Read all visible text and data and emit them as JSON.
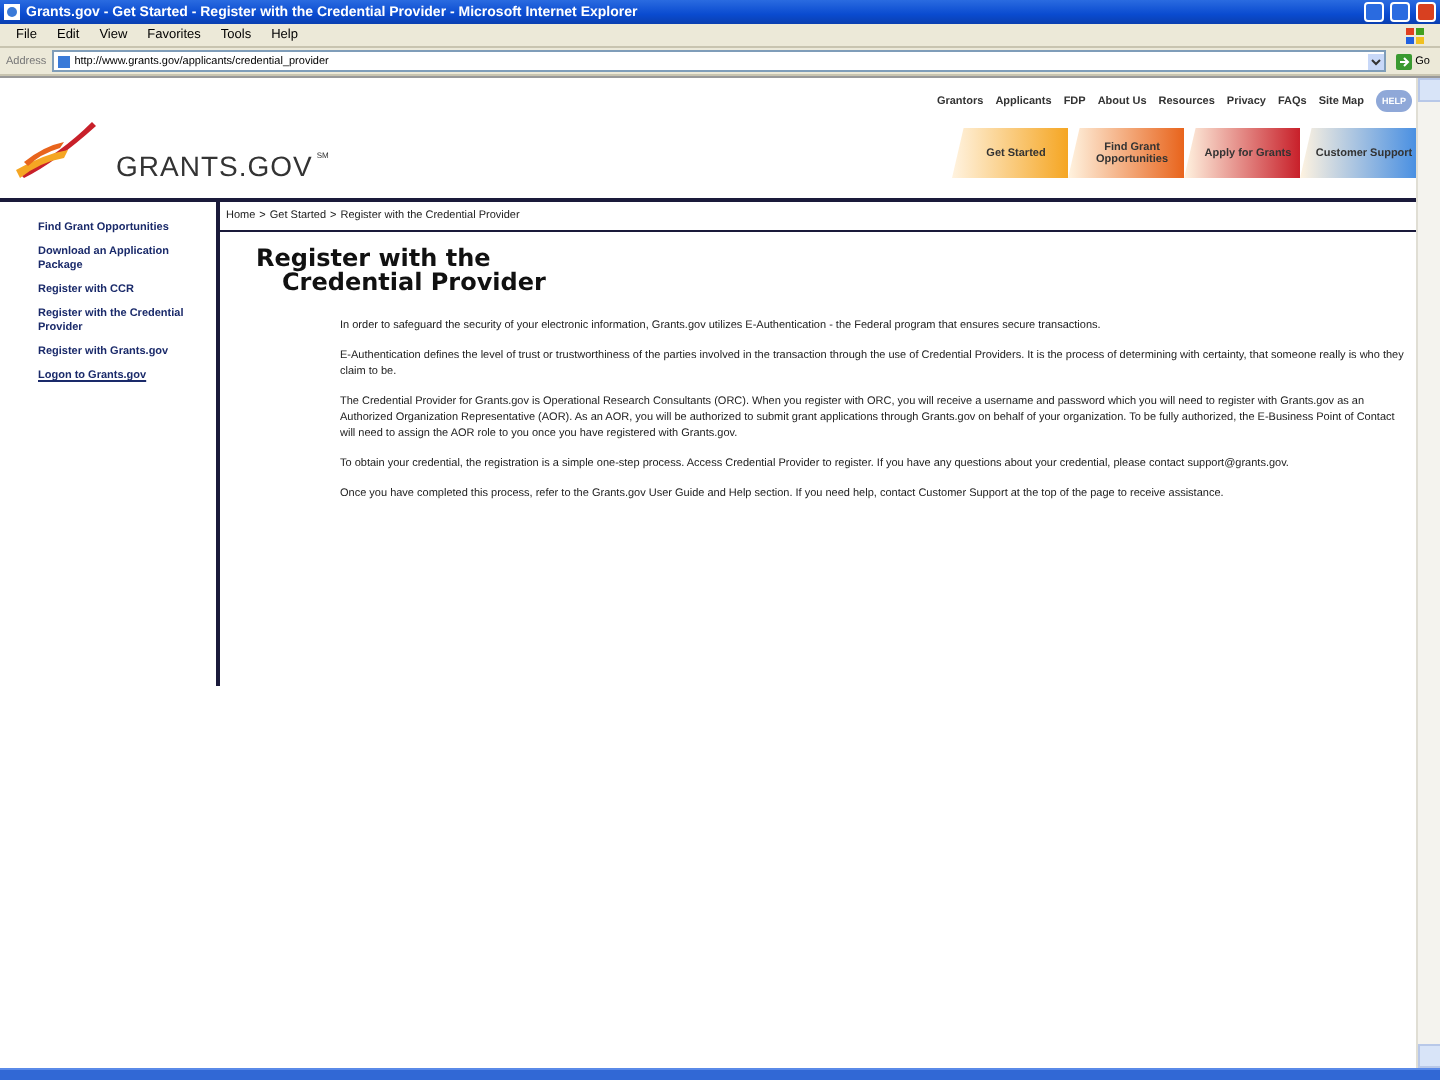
{
  "window": {
    "title": "Grants.gov - Get Started - Register with the Credential Provider - Microsoft Internet Explorer"
  },
  "menu": [
    "File",
    "Edit",
    "View",
    "Favorites",
    "Tools",
    "Help"
  ],
  "address": {
    "label": "Address",
    "url": "http://www.grants.gov/applicants/credential_provider",
    "go": "Go"
  },
  "logo": {
    "text": "GRANTS.GOV",
    "mark": "SM"
  },
  "top_links": [
    "Grantors",
    "Applicants",
    "FDP",
    "About Us",
    "Resources",
    "Privacy",
    "FAQs",
    "Site Map"
  ],
  "help_button": "HELP",
  "tabs": [
    {
      "label": "Get Started",
      "color": "#f5a623"
    },
    {
      "label": "Find Grant Opportunities",
      "color": "#e8641c"
    },
    {
      "label": "Apply for Grants",
      "color": "#c8202a"
    },
    {
      "label": "Customer Support",
      "color": "#4a90e2"
    }
  ],
  "sidebar": [
    {
      "label": "Find Grant Opportunities",
      "kind": "nav"
    },
    {
      "label": "Download an Application Package",
      "kind": "nav"
    },
    {
      "label": "Register with CCR",
      "kind": "nav"
    },
    {
      "label": "Register with the Credential Provider",
      "kind": "nav"
    },
    {
      "label": "Register with Grants.gov",
      "kind": "nav"
    },
    {
      "label": "Logon to Grants.gov",
      "kind": "link"
    }
  ],
  "breadcrumb_separator": ">",
  "breadcrumb": [
    "Home",
    "Get Started",
    "Register with the Credential Provider"
  ],
  "heading": [
    "Register with the",
    "Credential Provider"
  ],
  "paragraphs": [
    "In order to safeguard the security of your electronic information, Grants.gov utilizes E-Authentication - the Federal program that ensures secure transactions.",
    "E-Authentication defines the level of trust or trustworthiness of the parties involved in the transaction through the use of Credential Providers. It is the process of determining with certainty, that someone really is who they claim to be.",
    "The Credential Provider for Grants.gov is Operational Research Consultants (ORC). When you register with ORC, you will receive a username and password which you will need to register with Grants.gov as an Authorized Organization Representative (AOR). As an AOR, you will be authorized to submit grant applications through Grants.gov on behalf of your organization. To be fully authorized, the E-Business Point of Contact will need to assign the AOR role to you once you have registered with Grants.gov.",
    "To obtain your credential, the registration is a simple one-step process. Access Credential Provider to register. If you have any questions about your credential, please contact support@grants.gov.",
    "Once you have completed this process, refer to the Grants.gov User Guide and Help section. If you need help, contact Customer Support at the top of the page to receive assistance."
  ]
}
